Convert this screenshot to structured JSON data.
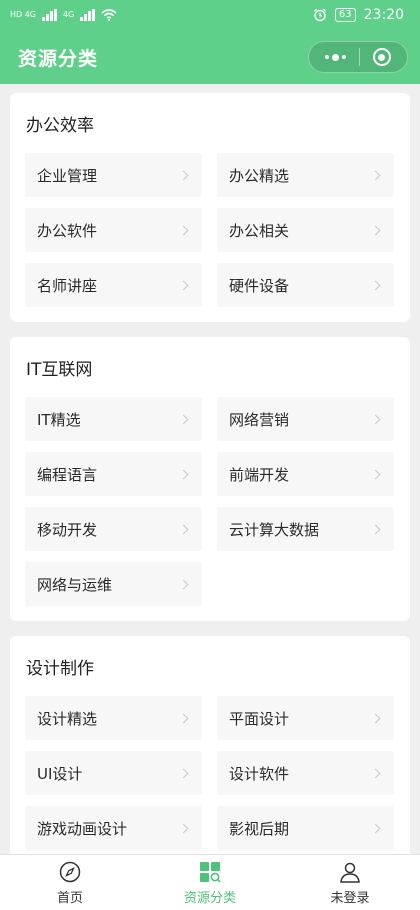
{
  "status_bar": {
    "network_left": "HD 4G",
    "network_right": "4G",
    "battery": "63",
    "time": "23:20"
  },
  "header": {
    "title": "资源分类"
  },
  "sections": [
    {
      "title": "办公效率",
      "items": [
        "企业管理",
        "办公精选",
        "办公软件",
        "办公相关",
        "名师讲座",
        "硬件设备"
      ]
    },
    {
      "title": "IT互联网",
      "items": [
        "IT精选",
        "网络营销",
        "编程语言",
        "前端开发",
        "移动开发",
        "云计算大数据",
        "网络与运维"
      ]
    },
    {
      "title": "设计制作",
      "items": [
        "设计精选",
        "平面设计",
        "UI设计",
        "设计软件",
        "游戏动画设计",
        "影视后期"
      ]
    }
  ],
  "tabbar": {
    "tabs": [
      {
        "label": "首页",
        "icon": "compass-icon",
        "active": false
      },
      {
        "label": "资源分类",
        "icon": "category-grid-icon",
        "active": true
      },
      {
        "label": "未登录",
        "icon": "user-icon",
        "active": false
      }
    ]
  },
  "colors": {
    "brand": "#5ed08a",
    "active_tab": "#4fc27a",
    "page_bg": "#efefef",
    "item_bg": "#f7f7f7"
  }
}
